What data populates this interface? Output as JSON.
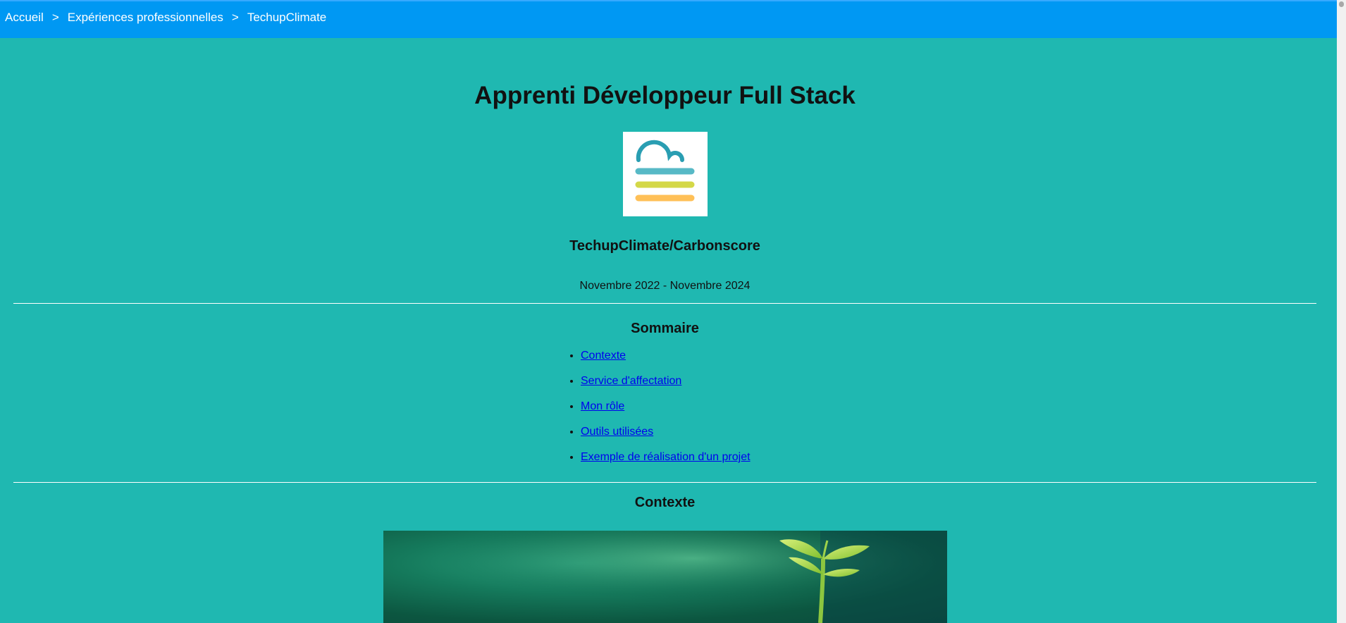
{
  "breadcrumb": {
    "items": [
      "Accueil",
      "Expériences professionnelles",
      "TechupClimate"
    ],
    "separator": ">"
  },
  "header": {
    "title": "Apprenti Développeur Full Stack",
    "company": "TechupClimate/Carbonscore",
    "dates": "Novembre 2022 - Novembre 2024"
  },
  "summary": {
    "title": "Sommaire",
    "items": [
      "Contexte",
      "Service d'affectation",
      "Mon rôle",
      "Outils utilisées",
      "Exemple de réalisation d'un projet"
    ]
  },
  "context": {
    "title": "Contexte",
    "image_icon": "plant-sprout-image"
  },
  "logo": {
    "icon": "cloud-lines-logo",
    "colors": [
      "#2a9eb2",
      "#57b9c6",
      "#d4d848",
      "#ffc057"
    ]
  },
  "colors": {
    "topbar": "#0098f3",
    "background": "#1fb8b1",
    "link": "#0000ee"
  }
}
